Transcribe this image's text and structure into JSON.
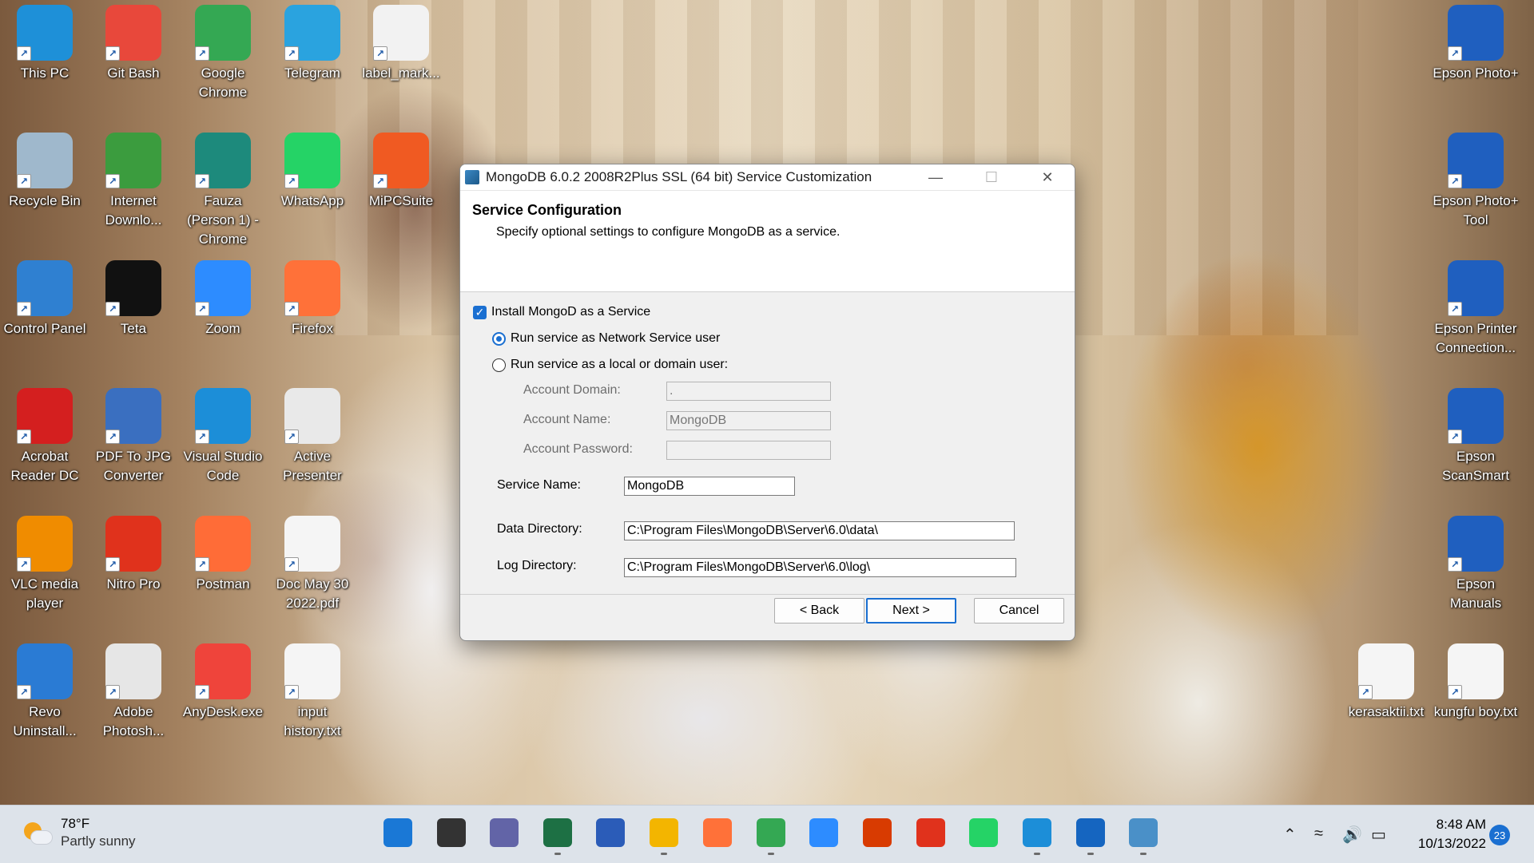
{
  "desktop": {
    "icons": [
      {
        "label": "This PC",
        "color": "#1e90d8"
      },
      {
        "label": "Git Bash",
        "color": "#e8483b"
      },
      {
        "label": "Google Chrome",
        "color": "#34a853"
      },
      {
        "label": "Telegram",
        "color": "#2aa3df"
      },
      {
        "label": "label_mark...",
        "color": "#f2f2f2"
      },
      {
        "label": "Recycle Bin",
        "color": "#9fb8cc"
      },
      {
        "label": "Internet Downlo...",
        "color": "#3b9c3e"
      },
      {
        "label": "Fauza (Person 1) - Chrome",
        "color": "#1d8a7c"
      },
      {
        "label": "WhatsApp",
        "color": "#25d366"
      },
      {
        "label": "MiPCSuite",
        "color": "#f05a22"
      },
      {
        "label": "Control Panel",
        "color": "#2f80d1"
      },
      {
        "label": "Teta",
        "color": "#111111"
      },
      {
        "label": "Zoom",
        "color": "#2d8cff"
      },
      {
        "label": "Firefox",
        "color": "#ff7139"
      },
      {
        "label": "Acrobat Reader DC",
        "color": "#d41f1f"
      },
      {
        "label": "PDF To JPG Converter",
        "color": "#3a6fc0"
      },
      {
        "label": "Visual Studio Code",
        "color": "#1c8ed8"
      },
      {
        "label": "Active Presenter",
        "color": "#e9e9e9"
      },
      {
        "label": "VLC media player",
        "color": "#f08c00"
      },
      {
        "label": "Nitro Pro",
        "color": "#e0321c"
      },
      {
        "label": "Postman",
        "color": "#ff6c37"
      },
      {
        "label": "Doc May 30 2022.pdf",
        "color": "#f5f5f5"
      },
      {
        "label": "Revo Uninstall...",
        "color": "#2a7bd4"
      },
      {
        "label": "Adobe Photosh...",
        "color": "#e6e6e6"
      },
      {
        "label": "AnyDesk.exe",
        "color": "#ef443b"
      },
      {
        "label": "input history.txt",
        "color": "#f5f5f5"
      },
      {
        "label": "Epson Photo+",
        "color": "#1f5fbf"
      },
      {
        "label": "Epson Photo+ Tool",
        "color": "#1f5fbf"
      },
      {
        "label": "Epson Printer Connection...",
        "color": "#1f5fbf"
      },
      {
        "label": "Epson ScanSmart",
        "color": "#1f5fbf"
      },
      {
        "label": "Epson Manuals",
        "color": "#1f5fbf"
      },
      {
        "label": "kerasaktii.txt",
        "color": "#f5f5f5"
      },
      {
        "label": "kungfu boy.txt",
        "color": "#f5f5f5"
      }
    ]
  },
  "dialog": {
    "title": "MongoDB 6.0.2 2008R2Plus SSL (64 bit) Service Customization",
    "heading": "Service Configuration",
    "subheading": "Specify optional settings to configure MongoDB as a service.",
    "install_service_label": "Install MongoD as a Service",
    "install_service_checked": true,
    "radio_network_label": "Run service as Network Service user",
    "radio_local_label": "Run service as a local or domain user:",
    "selected_radio": "network",
    "account_domain_label": "Account Domain:",
    "account_domain_value": ".",
    "account_name_label": "Account Name:",
    "account_name_value": "MongoDB",
    "account_password_label": "Account Password:",
    "account_password_value": "",
    "service_name_label": "Service Name:",
    "service_name_value": "MongoDB",
    "data_dir_label": "Data Directory:",
    "data_dir_value": "C:\\Program Files\\MongoDB\\Server\\6.0\\data\\",
    "log_dir_label": "Log Directory:",
    "log_dir_value": "C:\\Program Files\\MongoDB\\Server\\6.0\\log\\",
    "back_label": "< Back",
    "next_label": "Next >",
    "cancel_label": "Cancel",
    "minimize_glyph": "—",
    "maximize_glyph": "☐",
    "close_glyph": "✕"
  },
  "taskbar": {
    "weather_temp": "78°F",
    "weather_desc": "Partly sunny",
    "apps": [
      {
        "name": "start",
        "color": "#1a78d6"
      },
      {
        "name": "search",
        "color": "#333333"
      },
      {
        "name": "chat",
        "color": "#6264a7"
      },
      {
        "name": "excel",
        "color": "#1d7044"
      },
      {
        "name": "word",
        "color": "#2b5cb8"
      },
      {
        "name": "file-explorer",
        "color": "#f3b500"
      },
      {
        "name": "firefox",
        "color": "#ff7139"
      },
      {
        "name": "chrome",
        "color": "#34a853"
      },
      {
        "name": "zoom",
        "color": "#2d8cff"
      },
      {
        "name": "office",
        "color": "#d83b01"
      },
      {
        "name": "nitro",
        "color": "#e0321c"
      },
      {
        "name": "whatsapp",
        "color": "#25d366"
      },
      {
        "name": "vscode",
        "color": "#1c8ed8"
      },
      {
        "name": "media-player",
        "color": "#1565c0"
      },
      {
        "name": "setup",
        "color": "#4a90c8"
      }
    ],
    "time": "8:48 AM",
    "date": "10/13/2022",
    "notification_count": "23"
  }
}
